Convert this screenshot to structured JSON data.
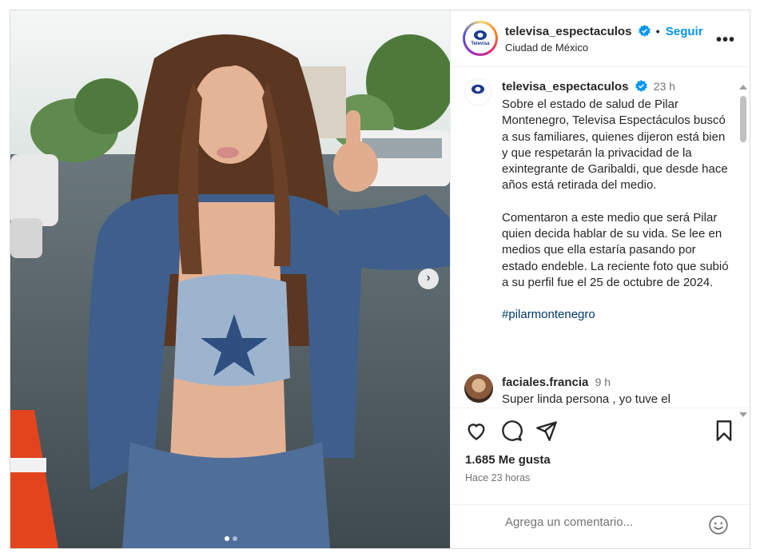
{
  "header": {
    "username": "televisa_espectaculos",
    "separator": "•",
    "follow_label": "Seguir",
    "location": "Ciudad de México",
    "more_label": "•••",
    "logo_text": "Televisa"
  },
  "caption": {
    "username": "televisa_espectaculos",
    "time": "23 h",
    "paragraph1": "Sobre el estado de salud de Pilar Montenegro, Televisa Espectáculos buscó a sus familiares, quienes dijeron está bien y que respetarán la privacidad de la exintegrante de Garibaldi, que desde hace años está retirada del medio.",
    "paragraph2": "Comentaron a este medio que será Pilar quien decida hablar de su vida. Se lee en medios que ella estaría pasando por estado endeble. La reciente foto que subió a su perfil fue el 25 de octubre de 2024.",
    "hashtag": "#pilarmontenegro"
  },
  "comment": {
    "username": "faciales.francia",
    "time": "9 h",
    "text": "Super linda persona , yo tuve el"
  },
  "stats": {
    "likes": "1.685 Me gusta",
    "posted_ago": "Hace 23 horas"
  },
  "comment_box": {
    "placeholder": "Agrega un comentario..."
  },
  "media": {
    "next_label": "›",
    "carousel_count": 2,
    "carousel_active": 0
  },
  "colors": {
    "accent": "#0095f6",
    "hashtag": "#00376b",
    "muted": "#737373"
  }
}
